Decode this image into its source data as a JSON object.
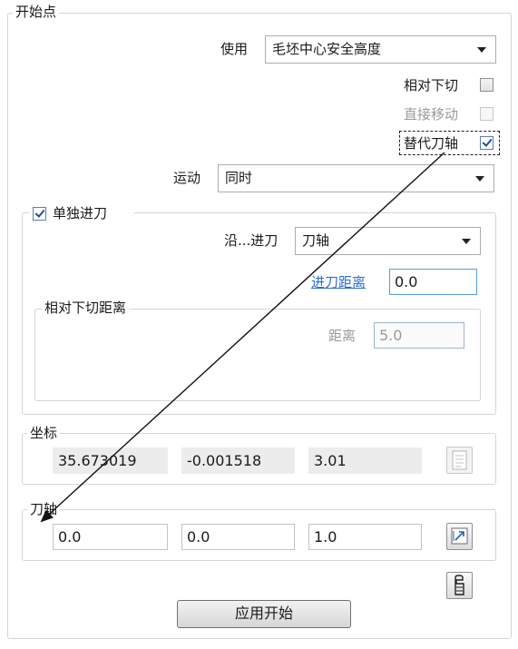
{
  "group_start_point": {
    "title": "开始点"
  },
  "use": {
    "label": "使用",
    "value": "毛坯中心安全高度"
  },
  "relative_down_cut": {
    "label": "相对下切",
    "checked": false
  },
  "direct_move": {
    "label": "直接移动",
    "checked": false,
    "disabled": true
  },
  "alt_tool_axis": {
    "label": "替代刀轴",
    "checked": true
  },
  "motion": {
    "label": "运动",
    "value": "同时"
  },
  "separate_lead_in": {
    "label": "单独进刀",
    "checked": true
  },
  "along_lead_in": {
    "label": "沿...进刀",
    "value": "刀轴"
  },
  "lead_in_distance": {
    "label": "进刀距离",
    "value": "0.0"
  },
  "relative_down_cut_distance": {
    "title": "相对下切距离",
    "distance_label": "距离",
    "distance_value": "5.0"
  },
  "coordinates": {
    "title": "坐标",
    "values": [
      "35.673019",
      "-0.001518",
      "3.01"
    ]
  },
  "tool_axis": {
    "title": "刀轴",
    "values": [
      "0.0",
      "0.0",
      "1.0"
    ]
  },
  "apply_button": {
    "label": "应用开始"
  },
  "colors": {
    "accent": "#2a6fcf",
    "check": "#1a4fa0"
  },
  "icons": [
    "dropdown-arrow-icon",
    "list-icon",
    "axis-arrow-icon",
    "tool-holder-icon"
  ]
}
